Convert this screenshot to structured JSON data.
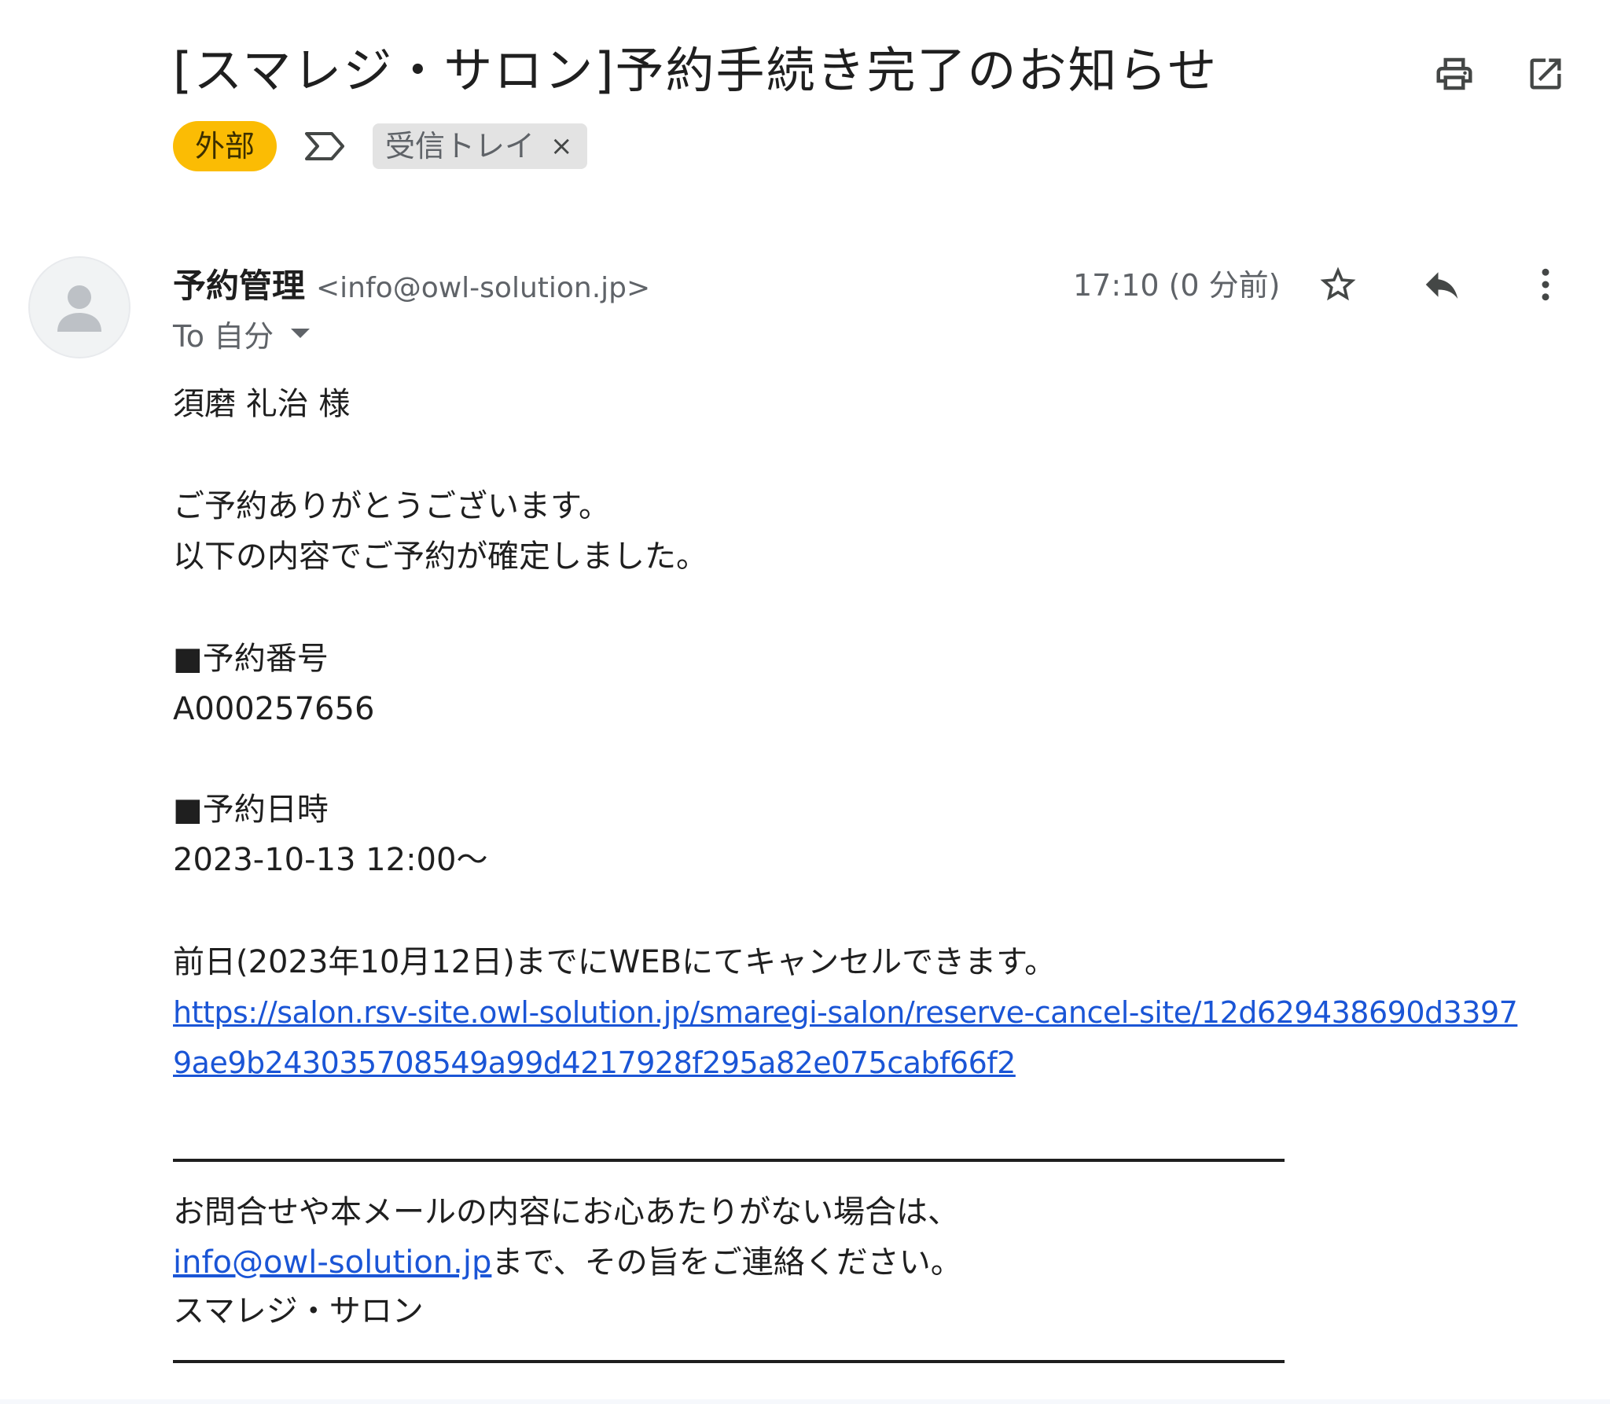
{
  "email": {
    "subject": "[スマレジ・サロン]予約手続き完了のお知らせ",
    "labels": {
      "external": "外部",
      "inbox": "受信トレイ",
      "inbox_remove": "×"
    },
    "sender": {
      "name": "予約管理",
      "email": "<info@owl-solution.jp>"
    },
    "time": "17:10 (0 分前)",
    "to": "To 自分",
    "body": {
      "greeting": "須磨 礼治 様",
      "thanks": "ご予約ありがとうございます。",
      "confirmed": "以下の内容でご予約が確定しました。",
      "reservation_number_heading": "■予約番号",
      "reservation_number": "A000257656",
      "reservation_datetime_heading": "■予約日時",
      "reservation_datetime": "2023-10-13 12:00～",
      "cancel_notice": "前日(2023年10月12日)までにWEBにてキャンセルできます。",
      "cancel_link_line1": "https://salon.rsv-site.owl-solution.jp/smaregi-salon/reserve-cancel-site/12d629438690d3397",
      "cancel_link_line2": "9ae9b243035708549a99d4217928f295a82e075cabf66f2",
      "contact_line1": "お問合せや本メールの内容にお心あたりがない場合は、",
      "contact_email": "info@owl-solution.jp",
      "contact_line2_suffix": "まで、その旨をご連絡ください。",
      "signature": "スマレジ・サロン"
    }
  },
  "icons": {
    "print": "print-icon",
    "open_new_window": "open-in-new-window-icon",
    "label_arrow": "label-arrow-icon",
    "avatar": "person-icon",
    "star": "star-icon",
    "reply": "reply-icon",
    "more": "more-vert-icon",
    "caret": "chevron-down-icon"
  },
  "colors": {
    "external_badge": "#fbbc04",
    "link": "#1a55d6",
    "chip_bg": "#e3e3e3",
    "secondary_text": "#5f6368"
  }
}
